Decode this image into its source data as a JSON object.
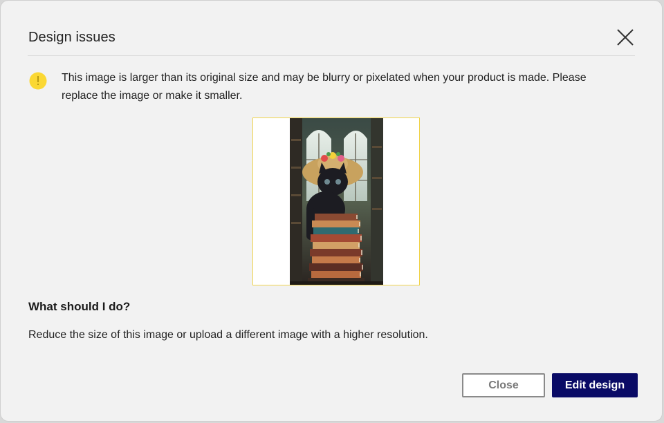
{
  "dialog": {
    "title": "Design issues",
    "close_icon": "close-icon"
  },
  "warning": {
    "icon": "warning-icon",
    "icon_color": "#fbd834",
    "message": "This image is larger than its original size and may be blurry or pixelated when your product is made. Please replace the image or make it smaller."
  },
  "preview": {
    "border_color": "#f0d34a"
  },
  "guidance": {
    "heading": "What should I do?",
    "body": "Reduce the size of this image or upload a different image with a higher resolution."
  },
  "actions": {
    "close_label": "Close",
    "edit_label": "Edit design",
    "primary_color": "#0a0b66"
  }
}
